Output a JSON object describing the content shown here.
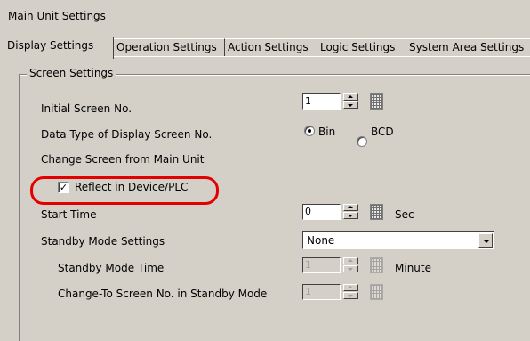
{
  "window": {
    "title": "Main Unit Settings"
  },
  "tabs": [
    {
      "label": "Display Settings",
      "active": true
    },
    {
      "label": "Operation Settings",
      "active": false
    },
    {
      "label": "Action Settings",
      "active": false
    },
    {
      "label": "Logic Settings",
      "active": false
    },
    {
      "label": "System Area Settings",
      "active": false
    }
  ],
  "group": {
    "title": "Screen Settings"
  },
  "initial_screen": {
    "label": "Initial Screen No.",
    "value": "1"
  },
  "data_type": {
    "label": "Data Type of Display Screen No.",
    "options": [
      "Bin",
      "BCD"
    ],
    "selected": "Bin"
  },
  "change_screen": {
    "label": "Change Screen from Main Unit"
  },
  "reflect": {
    "label": "Reflect in Device/PLC",
    "checked": true,
    "highlight_color": "#e30000"
  },
  "start_time": {
    "label": "Start Time",
    "value": "0",
    "unit": "Sec"
  },
  "standby": {
    "label": "Standby Mode Settings",
    "value": "None"
  },
  "standby_time": {
    "label": "Standby Mode Time",
    "value": "1",
    "unit": "Minute",
    "enabled": false
  },
  "standby_screen": {
    "label": "Change-To Screen No. in Standby Mode",
    "value": "1",
    "enabled": false
  }
}
